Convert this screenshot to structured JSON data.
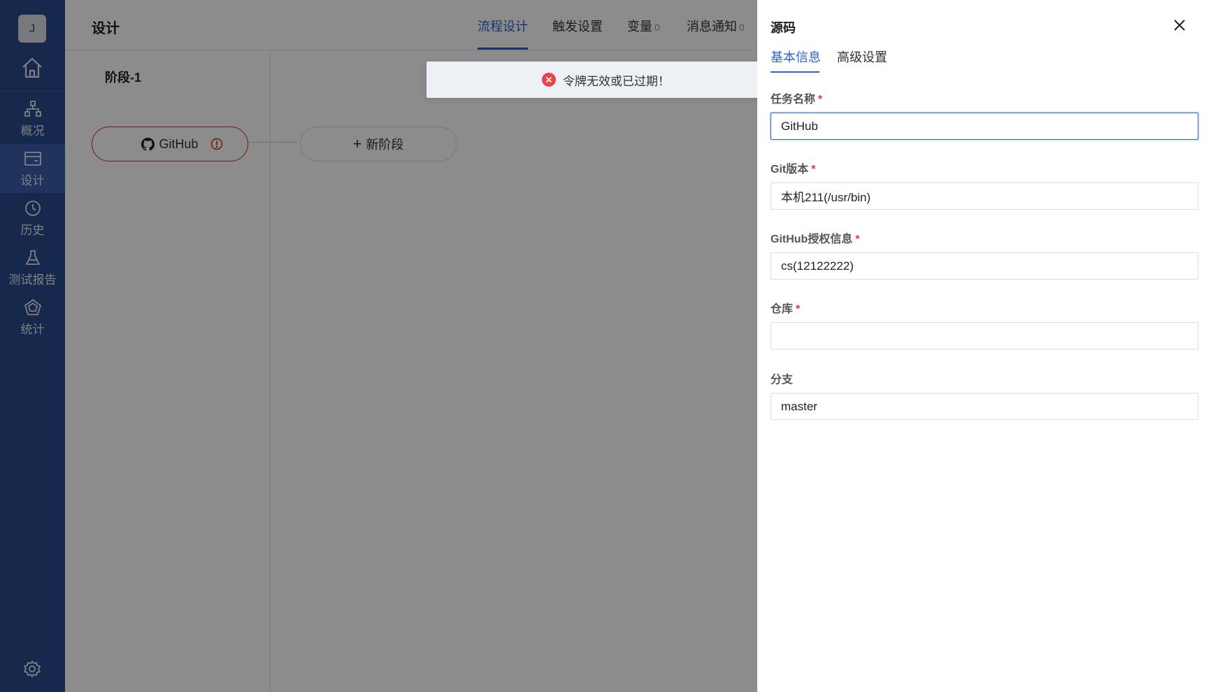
{
  "sidebar": {
    "avatar_letter": "J",
    "items": [
      {
        "label": "概况",
        "icon": "overview-icon"
      },
      {
        "label": "设计",
        "icon": "design-icon"
      },
      {
        "label": "历史",
        "icon": "history-icon"
      },
      {
        "label": "测试报告",
        "icon": "flask-icon"
      },
      {
        "label": "统计",
        "icon": "statistics-icon"
      }
    ]
  },
  "main": {
    "title": "设计",
    "tabs": [
      {
        "label": "流程设计",
        "count": ""
      },
      {
        "label": "触发设置",
        "count": ""
      },
      {
        "label": "变量",
        "count": "0"
      },
      {
        "label": "消息通知",
        "count": "0"
      }
    ],
    "stage": {
      "title": "阶段-1",
      "task_label": "GitHub"
    },
    "new_stage_label": "新阶段"
  },
  "toast": {
    "message": "令牌无效或已过期！"
  },
  "drawer": {
    "title": "源码",
    "tabs": [
      "基本信息",
      "高级设置"
    ],
    "fields": [
      {
        "label": "任务名称",
        "required": true,
        "value": "GitHub"
      },
      {
        "label": "Git版本",
        "required": true,
        "value": "本机211(/usr/bin)"
      },
      {
        "label": "GitHub授权信息",
        "required": true,
        "value": "cs(12122222)"
      },
      {
        "label": "仓库",
        "required": true,
        "value": ""
      },
      {
        "label": "分支",
        "required": false,
        "value": "master"
      }
    ]
  },
  "colors": {
    "sidebar": "#2b4a8c",
    "accent": "#2a63c8",
    "error": "#c9302c",
    "required": "#e0393e"
  }
}
